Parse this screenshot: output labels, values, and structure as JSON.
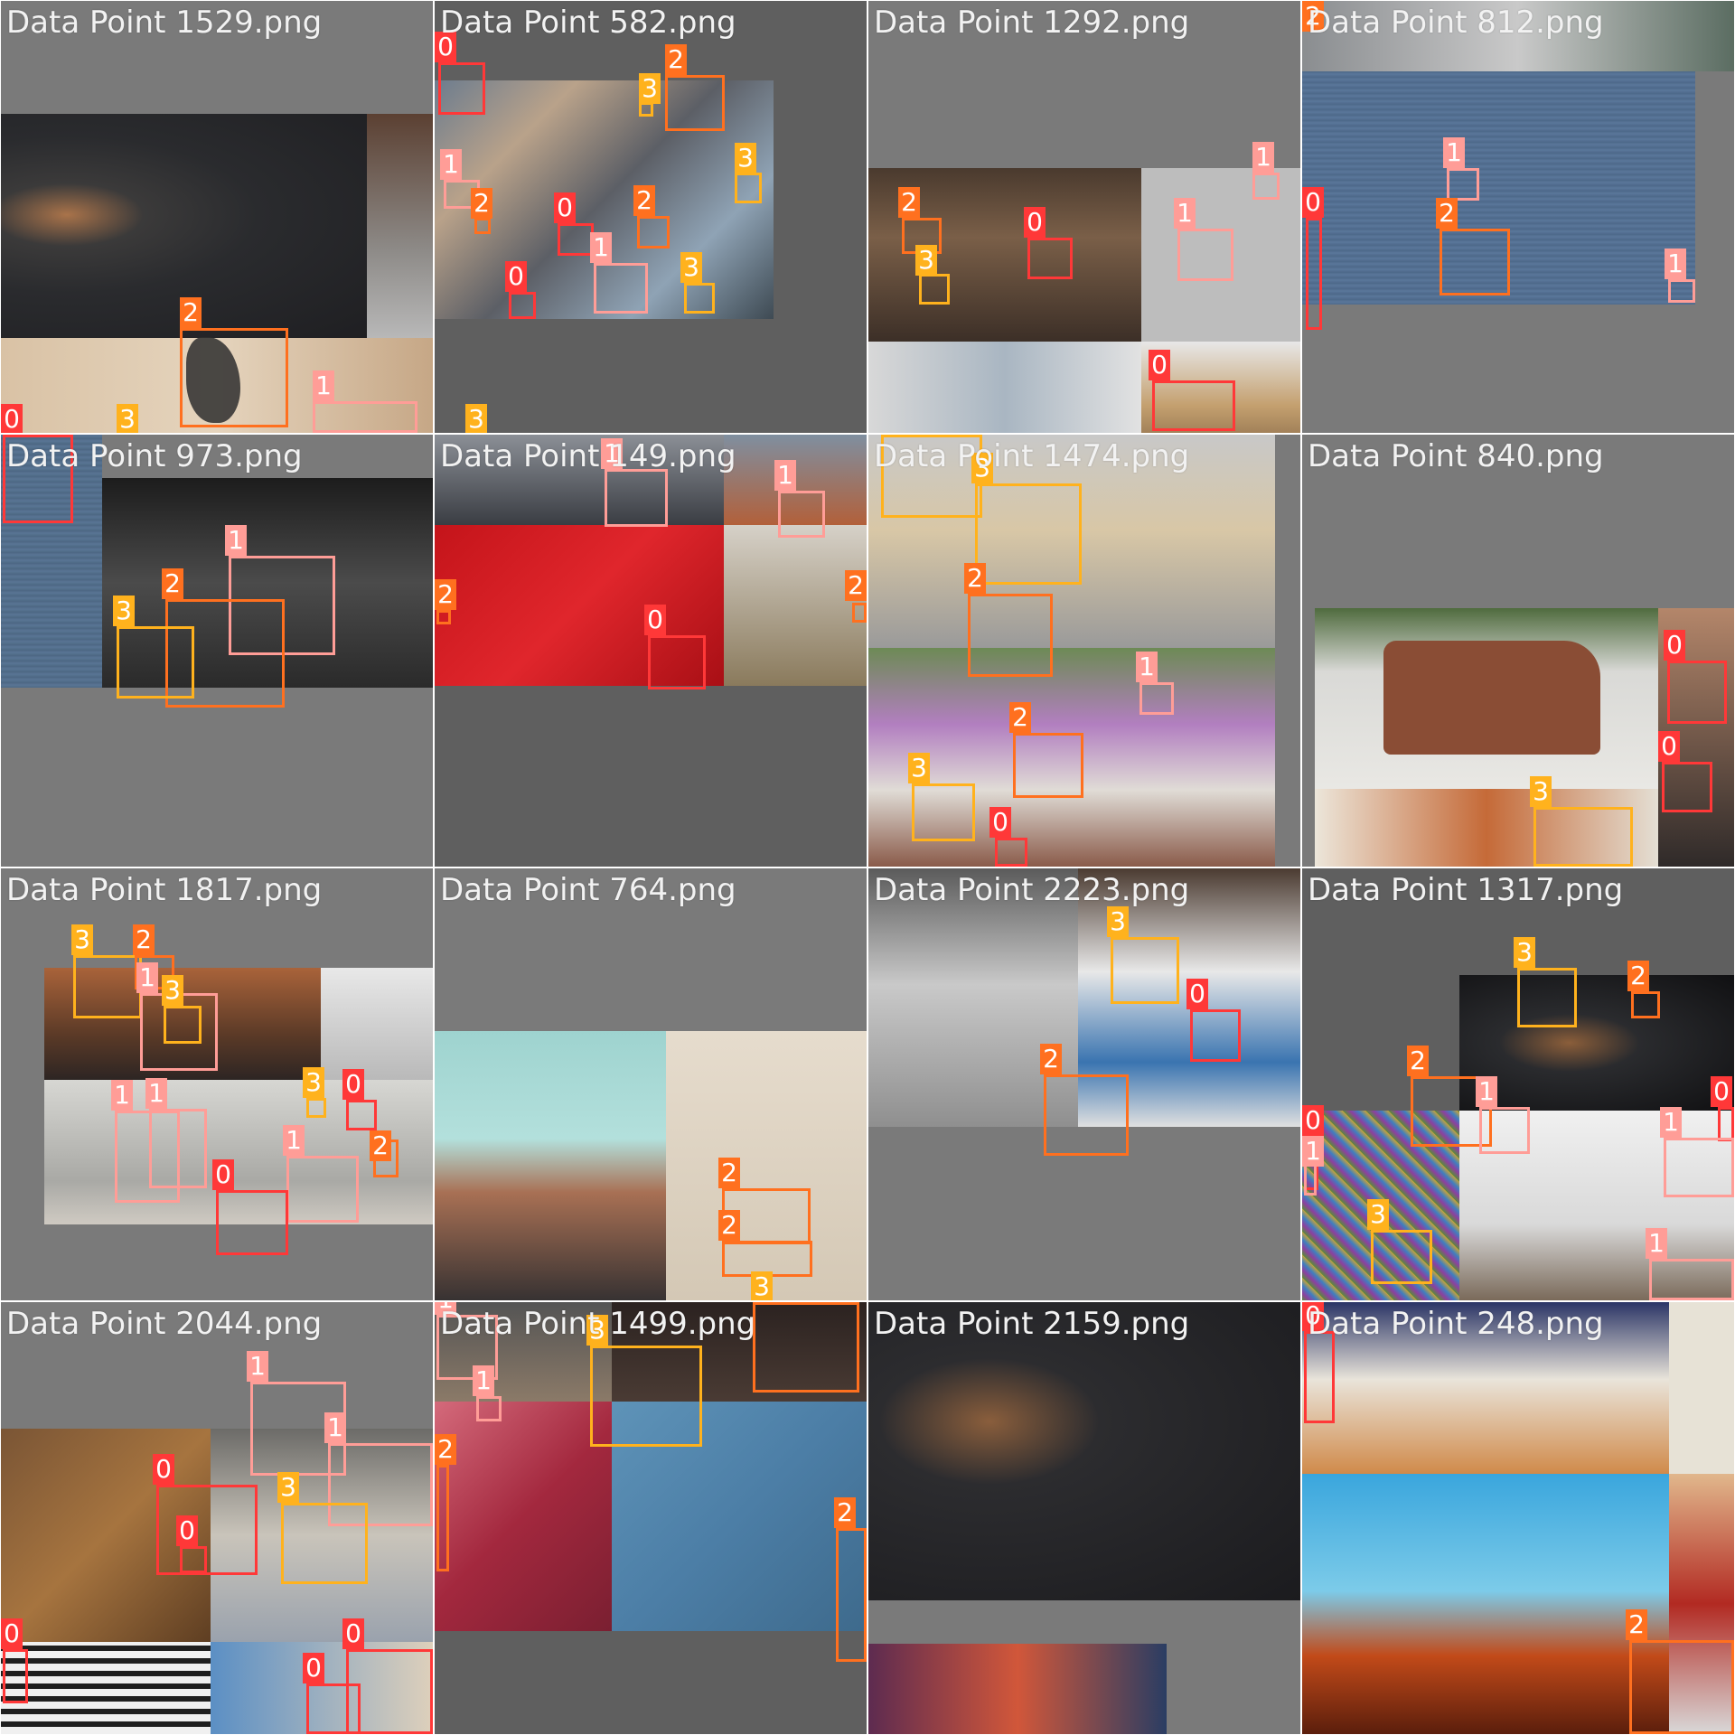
{
  "mosaic": {
    "tiles": [
      {
        "title": "Data Point 1529.png",
        "labels": [
          "2",
          "1",
          "3",
          "0"
        ]
      },
      {
        "title": "Data Point 582.png",
        "labels": [
          "0",
          "2",
          "3",
          "1",
          "2",
          "3",
          "0",
          "2",
          "1",
          "3",
          "0",
          "3"
        ]
      },
      {
        "title": "Data Point 1292.png",
        "labels": [
          "1",
          "2",
          "1",
          "0",
          "3",
          "0"
        ]
      },
      {
        "title": "Data Point 812.png",
        "labels": [
          "2",
          "1",
          "1",
          "0",
          "2",
          "1"
        ]
      },
      {
        "title": "Data Point 973.png",
        "labels": [
          "1",
          "2",
          "3",
          "0"
        ]
      },
      {
        "title": "Data Point 149.png",
        "labels": [
          "1",
          "1",
          "2",
          "0",
          "2"
        ]
      },
      {
        "title": "Data Point 1474.png",
        "labels": [
          "3",
          "3",
          "2",
          "1",
          "2",
          "3",
          "0"
        ]
      },
      {
        "title": "Data Point 840.png",
        "labels": [
          "0",
          "0",
          "3"
        ]
      },
      {
        "title": "Data Point 1817.png",
        "labels": [
          "3",
          "2",
          "1",
          "3",
          "3",
          "0",
          "1",
          "1",
          "2",
          "1",
          "0"
        ]
      },
      {
        "title": "Data Point 764.png",
        "labels": [
          "2",
          "2",
          "3"
        ]
      },
      {
        "title": "Data Point 2223.png",
        "labels": [
          "3",
          "0",
          "2"
        ]
      },
      {
        "title": "Data Point 1317.png",
        "labels": [
          "3",
          "2",
          "2",
          "1",
          "0",
          "0",
          "1",
          "1",
          "3",
          "1"
        ]
      },
      {
        "title": "Data Point 2044.png",
        "labels": [
          "1",
          "1",
          "0",
          "0",
          "3",
          "0",
          "0",
          "0"
        ]
      },
      {
        "title": "Data Point 1499.png",
        "labels": [
          "1",
          "3",
          "1",
          "2",
          "2"
        ]
      },
      {
        "title": "Data Point 2159.png",
        "labels": []
      },
      {
        "title": "Data Point 248.png",
        "labels": [
          "0",
          "2"
        ]
      }
    ]
  }
}
